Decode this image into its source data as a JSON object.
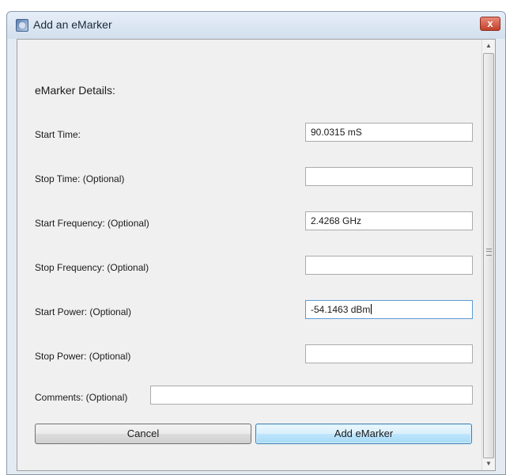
{
  "window": {
    "title": "Add an eMarker",
    "close_label": "x"
  },
  "form": {
    "section_title": "eMarker Details:",
    "fields": [
      {
        "label": "Start Time:",
        "value": "90.0315 mS"
      },
      {
        "label": "Stop Time: (Optional)",
        "value": ""
      },
      {
        "label": "Start Frequency: (Optional)",
        "value": "2.4268 GHz"
      },
      {
        "label": "Stop Frequency: (Optional)",
        "value": ""
      },
      {
        "label": "Start Power: (Optional)",
        "value": "-54.1463 dBm"
      },
      {
        "label": "Stop Power: (Optional)",
        "value": ""
      }
    ],
    "comments": {
      "label": "Comments: (Optional)",
      "value": ""
    }
  },
  "buttons": {
    "cancel": "Cancel",
    "add": "Add eMarker"
  },
  "colors": {
    "titlebar": "#d9e4f1",
    "close": "#c7442f",
    "primary_button": "#bee6fd"
  }
}
